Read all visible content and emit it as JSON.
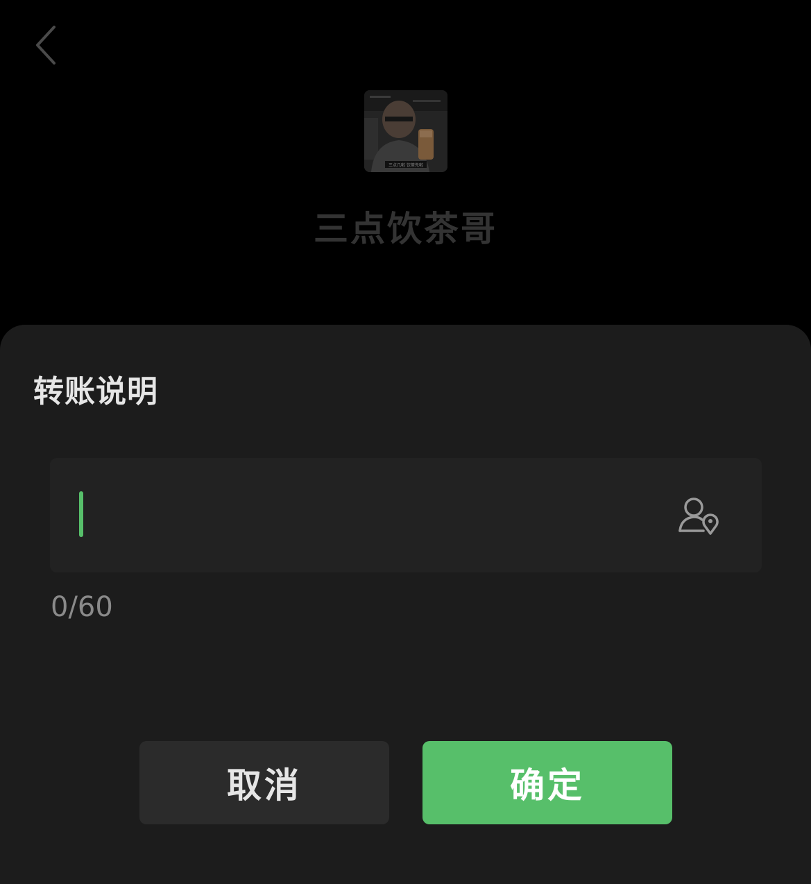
{
  "header": {
    "back_icon": "chevron-left-icon"
  },
  "recipient": {
    "name": "三点饮茶哥",
    "avatar_caption": "三点几啦 饮茶先啦"
  },
  "note_dialog": {
    "title": "转账说明",
    "input_value": "",
    "mention_icon": "person-location-icon",
    "counter": "0/60",
    "cancel_label": "取消",
    "confirm_label": "确定"
  },
  "colors": {
    "accent": "#57bf6a",
    "sheet_bg": "#1c1c1c",
    "field_bg": "#222222",
    "cancel_bg": "#2b2b2b"
  }
}
